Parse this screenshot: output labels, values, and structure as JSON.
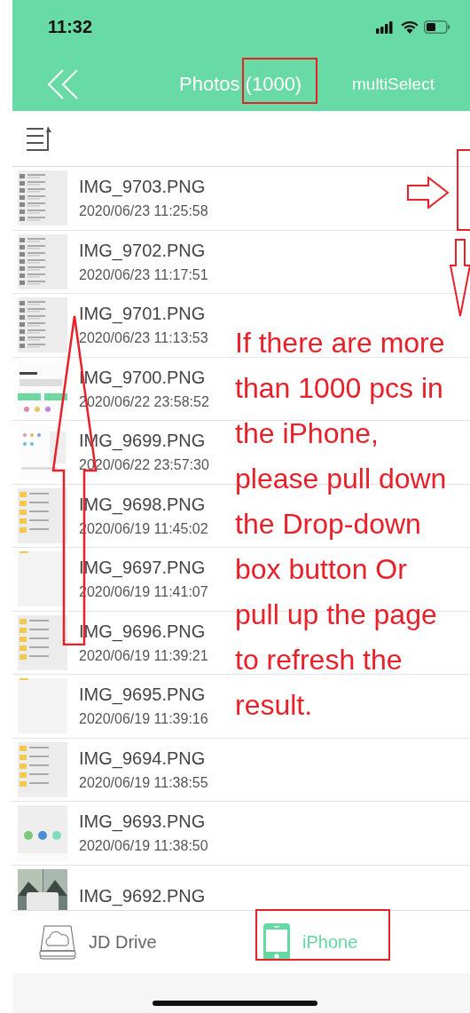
{
  "status_bar": {
    "time": "11:32"
  },
  "nav": {
    "title": "Photos (1000)",
    "action": "multiSelect"
  },
  "photos": [
    {
      "name": "IMG_9703.PNG",
      "date": "2020/06/23 11:25:58"
    },
    {
      "name": "IMG_9702.PNG",
      "date": "2020/06/23 11:17:51"
    },
    {
      "name": "IMG_9701.PNG",
      "date": "2020/06/23 11:13:53"
    },
    {
      "name": "IMG_9700.PNG",
      "date": "2020/06/22 23:58:52"
    },
    {
      "name": "IMG_9699.PNG",
      "date": "2020/06/22 23:57:30"
    },
    {
      "name": "IMG_9698.PNG",
      "date": "2020/06/19 11:45:02"
    },
    {
      "name": "IMG_9697.PNG",
      "date": "2020/06/19 11:41:07"
    },
    {
      "name": "IMG_9696.PNG",
      "date": "2020/06/19 11:39:21"
    },
    {
      "name": "IMG_9695.PNG",
      "date": "2020/06/19 11:39:16"
    },
    {
      "name": "IMG_9694.PNG",
      "date": "2020/06/19 11:38:55"
    },
    {
      "name": "IMG_9693.PNG",
      "date": "2020/06/19 11:38:50"
    },
    {
      "name": "IMG_9692.PNG"
    }
  ],
  "tabs": [
    {
      "label": "JD Drive",
      "selected": false
    },
    {
      "label": "iPhone",
      "selected": true
    }
  ],
  "annotation": {
    "note": "If there are more than 1000 pcs in the iPhone, please pull down the Drop-down box button Or pull up the page to refresh the result."
  }
}
